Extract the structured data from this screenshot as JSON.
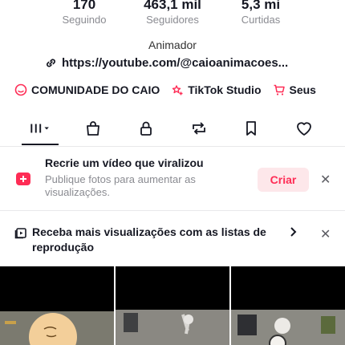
{
  "stats": [
    {
      "value": "170",
      "label": "Seguindo"
    },
    {
      "value": "463,1 mil",
      "label": "Seguidores"
    },
    {
      "value": "5,3 mi",
      "label": "Curtidas"
    }
  ],
  "bio": "Animador",
  "link": "https://youtube.com/@caioanimacoes...",
  "chips": [
    {
      "label": "COMUNIDADE DO CAIO",
      "icon": "community-icon"
    },
    {
      "label": "TikTok Studio",
      "icon": "studio-icon"
    },
    {
      "label": "Seus",
      "icon": "cart-icon"
    }
  ],
  "tabs": [
    "grid-icon",
    "shop-bag-icon",
    "lock-icon",
    "repost-icon",
    "bookmark-icon",
    "heart-icon"
  ],
  "card1": {
    "title": "Recrie um vídeo que viralizou",
    "subtitle": "Publique fotos para aumentar as visualizações.",
    "button": "Criar"
  },
  "card2": {
    "text": "Receba mais visualizações com as listas de reprodução"
  },
  "colors": {
    "accent": "#fe2c55",
    "text": "#161823",
    "muted": "#8a8b91"
  }
}
